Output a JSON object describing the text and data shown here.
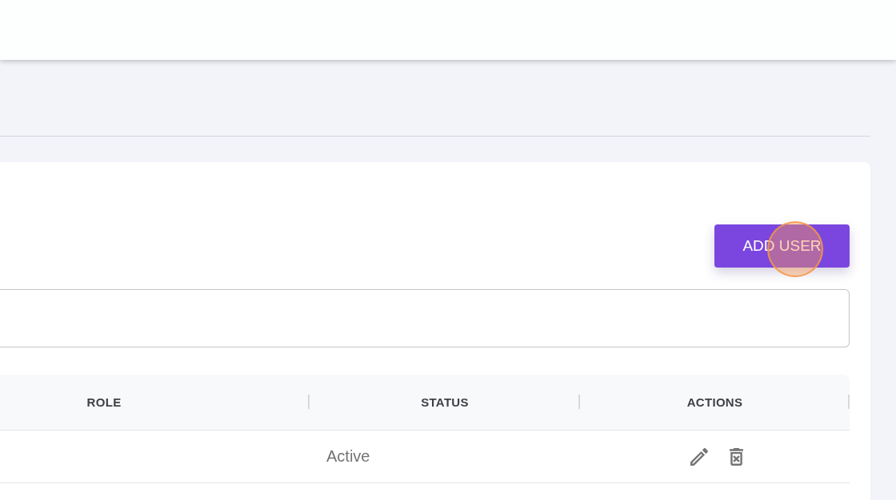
{
  "toolbar": {
    "add_button": "ADD USER"
  },
  "table": {
    "columns": [
      "ROLE",
      "STATUS",
      "ACTIONS"
    ],
    "rows": [
      {
        "status": "Active"
      }
    ]
  }
}
